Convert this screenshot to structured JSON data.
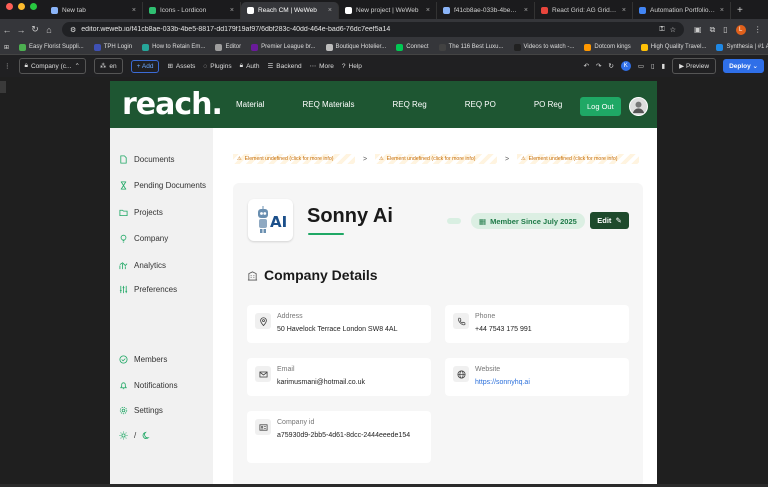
{
  "browser": {
    "tabs": [
      {
        "title": "New tab",
        "active": false,
        "color": "#8ab4f8"
      },
      {
        "title": "Icons - Lordicon",
        "active": false,
        "color": "#2fbf71"
      },
      {
        "title": "Reach CM | WeWeb",
        "active": true,
        "color": "#ffffff"
      },
      {
        "title": "New project | WeWeb",
        "active": false,
        "color": "#ffffff"
      },
      {
        "title": "f41cb8ae-033b-4be5-8f",
        "active": false,
        "color": "#8ab4f8"
      },
      {
        "title": "React Grid: AG Grid: Re",
        "active": false,
        "color": "#e8453c"
      },
      {
        "title": "Automation Portfolio | S",
        "active": false,
        "color": "#4285f4"
      }
    ],
    "url": "editor.weweb.io/f41cb8ae-033b-4be5-8817-dd179f19af97/6dbf283c-40dd-464e-bad6-76dc7eef5a14",
    "profile_initial": "L",
    "bookmarks": [
      {
        "label": "Easy Florist Suppli...",
        "color": "#4caf50"
      },
      {
        "label": "TPH Login",
        "color": "#3f51b5"
      },
      {
        "label": "How to Retain Em...",
        "color": "#26a69a"
      },
      {
        "label": "Editor",
        "color": "#9e9e9e"
      },
      {
        "label": "Premier League br...",
        "color": "#6a1b9a"
      },
      {
        "label": "Boutique Hotelier...",
        "color": "#bdbdbd"
      },
      {
        "label": "Connect",
        "color": "#00c853"
      },
      {
        "label": "The 116 Best Luxu...",
        "color": "#424242"
      },
      {
        "label": "Videos to watch -...",
        "color": "#212121"
      },
      {
        "label": "Dotcom kings",
        "color": "#ff9800"
      },
      {
        "label": "High Quality Travel...",
        "color": "#ffc107"
      },
      {
        "label": "Synthesia | #1 AI V...",
        "color": "#1e88e5"
      }
    ]
  },
  "editor": {
    "page_select": "Company (c...",
    "lang": "en",
    "add": "+ Add",
    "links": [
      "Assets",
      "Plugins",
      "Auth",
      "Backend",
      "More",
      "Help"
    ],
    "profile_initial": "K",
    "preview": "Preview",
    "deploy": "Deploy"
  },
  "site": {
    "logo": "reach.",
    "nav": [
      "Material",
      "REQ Materials",
      "REQ Reg",
      "REQ PO",
      "PO Reg"
    ],
    "logout": "Log Out",
    "sidebar": [
      "Documents",
      "Pending Documents",
      "Projects",
      "Company",
      "Analytics",
      "Preferences"
    ],
    "sidebar_bottom": [
      "Members",
      "Notifications",
      "Settings"
    ],
    "theme_sep": "/",
    "crumbs": [
      "Element undefined (click for more info)",
      "Element undefined (click for more info)",
      "Element undefined (click for more info)"
    ],
    "crumb_sep": ">",
    "company": {
      "name": "Sonny Ai",
      "member_since": "Member Since July 2025",
      "edit": "Edit",
      "section_title": "Company Details",
      "address_label": "Address",
      "address": "50 Havelock Terrace London SW8 4AL",
      "phone_label": "Phone",
      "phone": "+44 7543 175 991",
      "email_label": "Email",
      "email": "karimusmani@hotmail.co.uk",
      "website_label": "Website",
      "website": "https://sonnyhq.ai",
      "company_id_label": "Company id",
      "company_id": "a75930d9-2bb5-4d61-8dcc-2444eeede154"
    }
  },
  "colors": {
    "brand_green": "#1e5632",
    "accent_green": "#1fa865",
    "deploy_blue": "#2f6fe8"
  }
}
